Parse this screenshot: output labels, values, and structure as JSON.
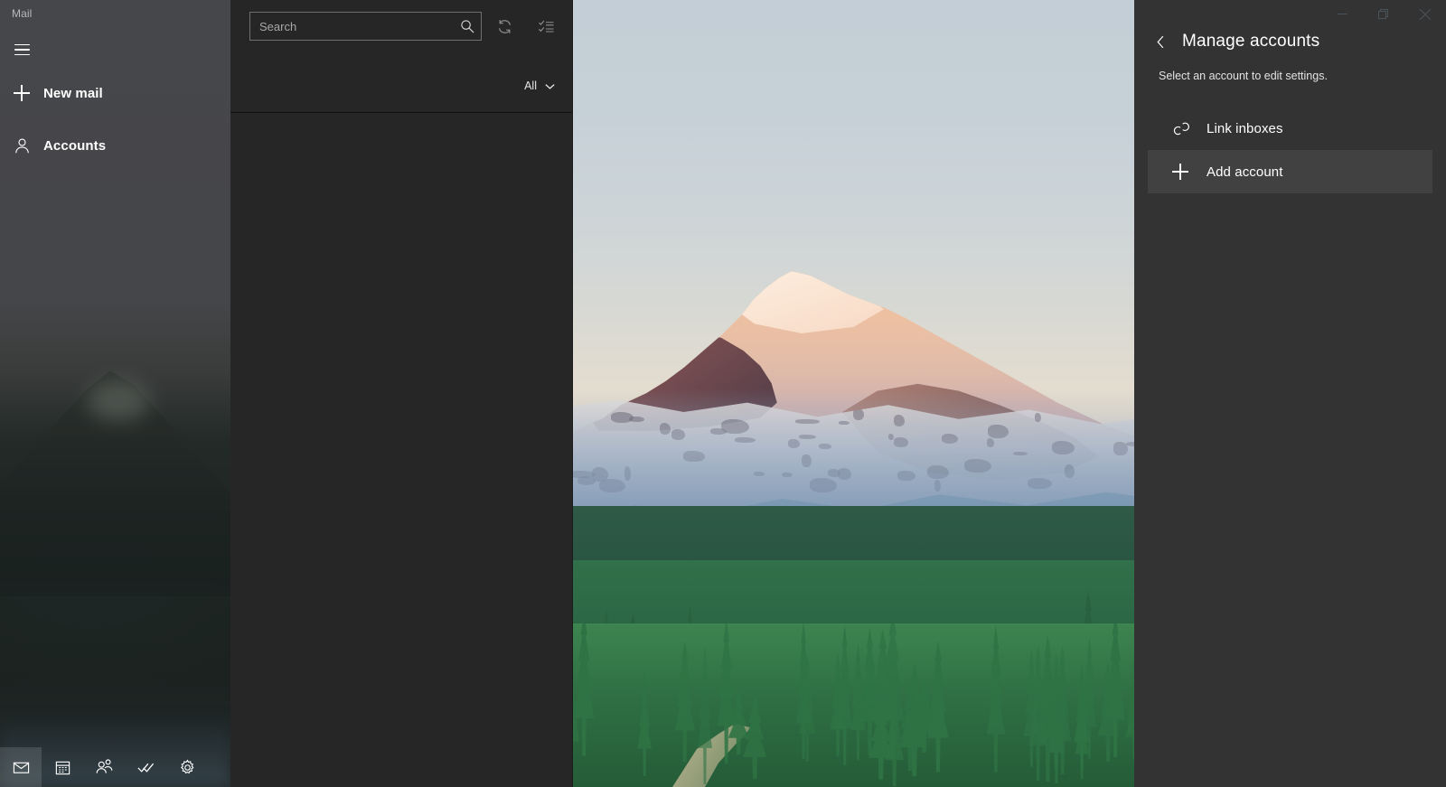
{
  "window": {
    "app_title": "Mail",
    "controls": {
      "minimize": "Minimize",
      "maximize": "Restore",
      "close": "Close"
    }
  },
  "sidebar": {
    "menu_button": "Navigation menu",
    "items": [
      {
        "label": "New mail",
        "icon": "plus-icon"
      },
      {
        "label": "Accounts",
        "icon": "person-icon"
      }
    ],
    "appbar": [
      {
        "label": "Mail",
        "icon": "mail-icon",
        "active": true
      },
      {
        "label": "Calendar",
        "icon": "calendar-icon",
        "active": false
      },
      {
        "label": "People",
        "icon": "people-icon",
        "active": false
      },
      {
        "label": "To Do",
        "icon": "todo-icon",
        "active": false
      },
      {
        "label": "Settings",
        "icon": "gear-icon",
        "active": false
      }
    ]
  },
  "message_list": {
    "search": {
      "placeholder": "Search",
      "value": "",
      "icon": "search-icon"
    },
    "sync_button": "Sync this view",
    "select_button": "Enter selection mode",
    "filter": {
      "label": "All",
      "chevron": "chevron-down-icon"
    },
    "items": []
  },
  "accounts_pane": {
    "back_label": "Back",
    "title": "Manage accounts",
    "subtitle": "Select an account to edit settings.",
    "rows": [
      {
        "label": "Link inboxes",
        "icon": "link-icon",
        "hovered": false
      },
      {
        "label": "Add account",
        "icon": "plus-icon",
        "hovered": true
      }
    ]
  },
  "colors": {
    "sidebar_bg": "#3f4042",
    "list_bg": "#262626",
    "pane_bg": "#333333",
    "pane_row_hover": "#414141",
    "text_primary": "#ffffff",
    "text_secondary": "#b9b9b9",
    "search_border": "#6e6e6e"
  }
}
